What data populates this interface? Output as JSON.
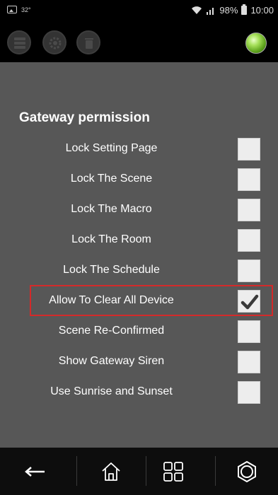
{
  "status_bar": {
    "temperature": "32°",
    "battery_percent": "98%",
    "time": "10:00"
  },
  "toolbar": {
    "icons": [
      "database-icon",
      "gear-icon",
      "trash-icon"
    ],
    "status_led_color": "#7dc63a"
  },
  "section_title": "Gateway permission",
  "permissions": [
    {
      "label": "Lock Setting Page",
      "checked": false
    },
    {
      "label": "Lock The Scene",
      "checked": false
    },
    {
      "label": "Lock The Macro",
      "checked": false
    },
    {
      "label": "Lock The Room",
      "checked": false
    },
    {
      "label": "Lock The Schedule",
      "checked": false
    },
    {
      "label": "Allow To Clear All Device",
      "checked": true
    },
    {
      "label": "Scene Re-Confirmed",
      "checked": false
    },
    {
      "label": "Show Gateway Siren",
      "checked": false
    },
    {
      "label": "Use Sunrise and Sunset",
      "checked": false
    }
  ],
  "highlight_color": "#d42a2a",
  "nav": {
    "items": [
      "back-arrow-icon",
      "home-icon",
      "grid-icon",
      "settings-icon"
    ]
  }
}
